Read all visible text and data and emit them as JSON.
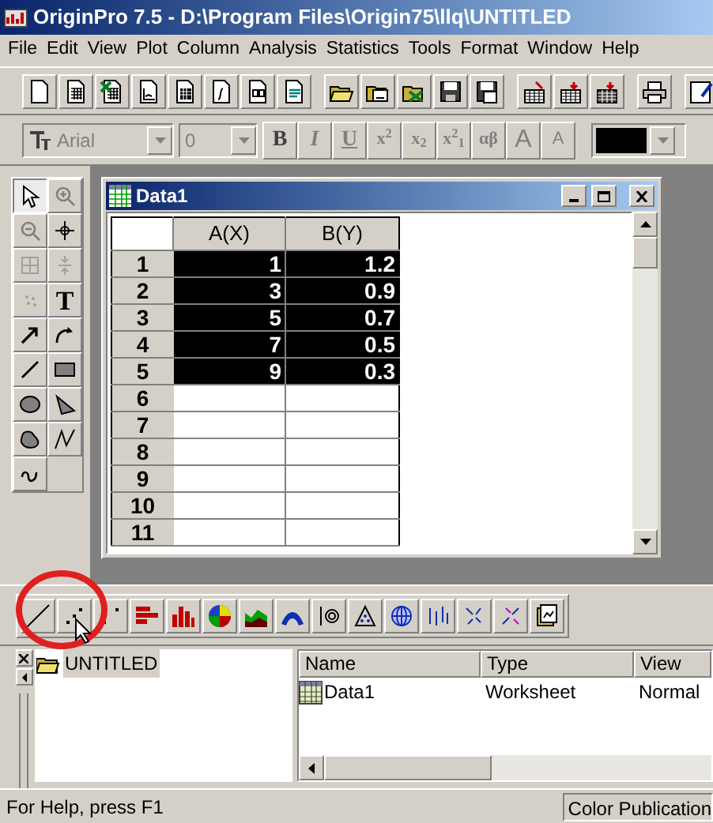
{
  "window": {
    "title": "OriginPro 7.5 - D:\\Program Files\\Origin75\\llq\\UNTITLED"
  },
  "menu": [
    "File",
    "Edit",
    "View",
    "Plot",
    "Column",
    "Analysis",
    "Statistics",
    "Tools",
    "Format",
    "Window",
    "Help"
  ],
  "format_bar": {
    "font": "Arial",
    "size": "0",
    "buttons": [
      {
        "label": "B",
        "kind": "bold"
      },
      {
        "label": "I",
        "kind": "italic"
      },
      {
        "label": "U",
        "kind": "underline"
      },
      {
        "label": "x$^{2}$",
        "kind": "plain"
      },
      {
        "label": "x$_{2}$",
        "kind": "plain"
      },
      {
        "label": "x$^{2}$$_{1}$",
        "kind": "plain"
      },
      {
        "label": "αβ",
        "kind": "plain"
      },
      {
        "label": "A",
        "kind": "grow"
      },
      {
        "label": "A",
        "kind": "shrink"
      }
    ]
  },
  "tools": [
    {
      "kind": "pointer",
      "selected": true
    },
    {
      "kind": "zoom-in",
      "selected": false
    },
    {
      "kind": "zoom-out",
      "selected": false
    },
    {
      "kind": "crosshair",
      "selected": false
    },
    {
      "kind": "grid",
      "selected": false
    },
    {
      "kind": "move",
      "selected": false
    },
    {
      "kind": "dots",
      "selected": false
    },
    {
      "kind": "text",
      "label": "T",
      "selected": false
    },
    {
      "kind": "arrow",
      "selected": false
    },
    {
      "kind": "curve-arrow",
      "selected": false
    },
    {
      "kind": "line",
      "selected": false
    },
    {
      "kind": "rect",
      "selected": false
    },
    {
      "kind": "ellipse",
      "selected": false
    },
    {
      "kind": "polygon",
      "selected": false
    },
    {
      "kind": "blob",
      "selected": false
    },
    {
      "kind": "polyline",
      "selected": false
    },
    {
      "kind": "freehand",
      "selected": false
    }
  ],
  "worksheet": {
    "title": "Data1",
    "columns": [
      "A(X)",
      "B(Y)"
    ],
    "rows": [
      {
        "label": "1",
        "a": "1",
        "b": "1.2",
        "selected": true
      },
      {
        "label": "2",
        "a": "3",
        "b": "0.9",
        "selected": true
      },
      {
        "label": "3",
        "a": "5",
        "b": "0.7",
        "selected": true
      },
      {
        "label": "4",
        "a": "7",
        "b": "0.5",
        "selected": true
      },
      {
        "label": "5",
        "a": "9",
        "b": "0.3",
        "selected": true
      },
      {
        "label": "6",
        "selected": false
      },
      {
        "label": "7",
        "selected": false
      },
      {
        "label": "8",
        "selected": false
      },
      {
        "label": "9",
        "selected": false
      },
      {
        "label": "10",
        "selected": false
      },
      {
        "label": "11",
        "selected": false
      }
    ]
  },
  "project_explorer": {
    "tree": [
      {
        "label": "UNTITLED",
        "selected": true
      }
    ],
    "columns": [
      "Name",
      "Type",
      "View"
    ],
    "rows": [
      {
        "name": "Data1",
        "type": "Worksheet",
        "view": "Normal"
      }
    ]
  },
  "status_bar": {
    "help": "For Help, press F1",
    "mode": "Color Publication"
  }
}
